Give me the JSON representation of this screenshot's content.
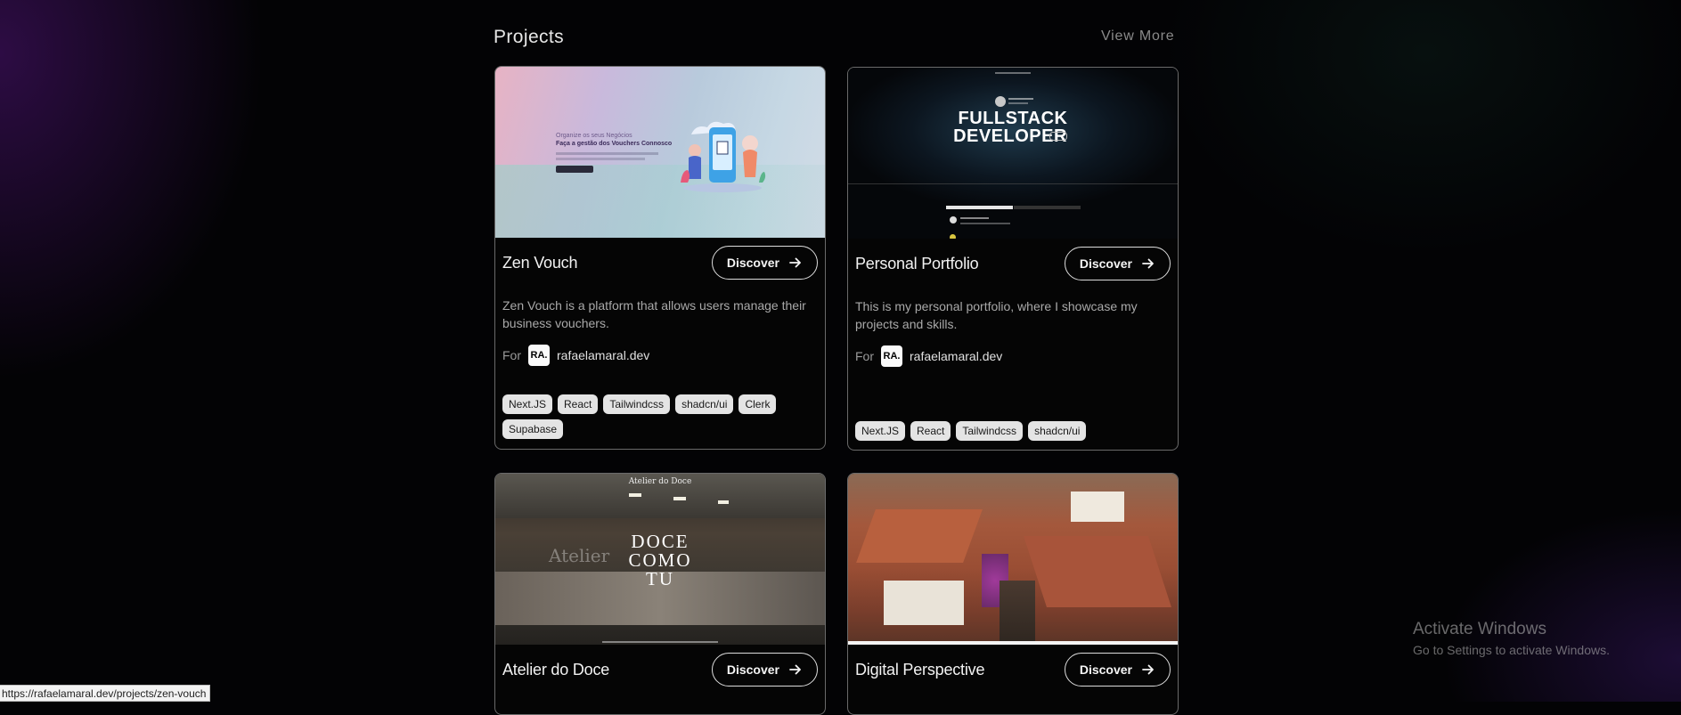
{
  "section": {
    "title": "Projects",
    "view_more": "View More"
  },
  "discover_label": "Discover",
  "for_label": "For",
  "owner": {
    "logo": "RA.",
    "link": "rafaelamaral.dev"
  },
  "projects": [
    {
      "title": "Zen Vouch",
      "description": "Zen Vouch is a platform that allows users manage their business vouchers.",
      "tags": [
        "Next.JS",
        "React",
        "Tailwindcss",
        "shadcn/ui",
        "Clerk",
        "Supabase"
      ],
      "thumb": {
        "headline": "Faça a gestão dos Vouchers Connosco",
        "kicker": "Organize os seus Negócios"
      }
    },
    {
      "title": "Personal Portfolio",
      "description": "This is my personal portfolio, where I showcase my projects and skills.",
      "tags": [
        "Next.JS",
        "React",
        "Tailwindcss",
        "shadcn/ui"
      ],
      "thumb": {
        "line1": "FULLSTACK",
        "line2": "DEVELOPER"
      }
    },
    {
      "title": "Atelier do Doce",
      "thumb": {
        "brand": "Atelier do Doce",
        "line1": "DOCE",
        "line2": "COMO",
        "line3": "TU"
      }
    },
    {
      "title": "Digital Perspective"
    }
  ],
  "status_bar": {
    "url": "https://rafaelamaral.dev/projects/zen-vouch"
  },
  "watermark": {
    "title": "Activate Windows",
    "subtitle": "Go to Settings to activate Windows."
  },
  "colors": {
    "background": "#030305",
    "card_border": "#6a6a6a",
    "tag_bg": "#e4e4e4"
  }
}
